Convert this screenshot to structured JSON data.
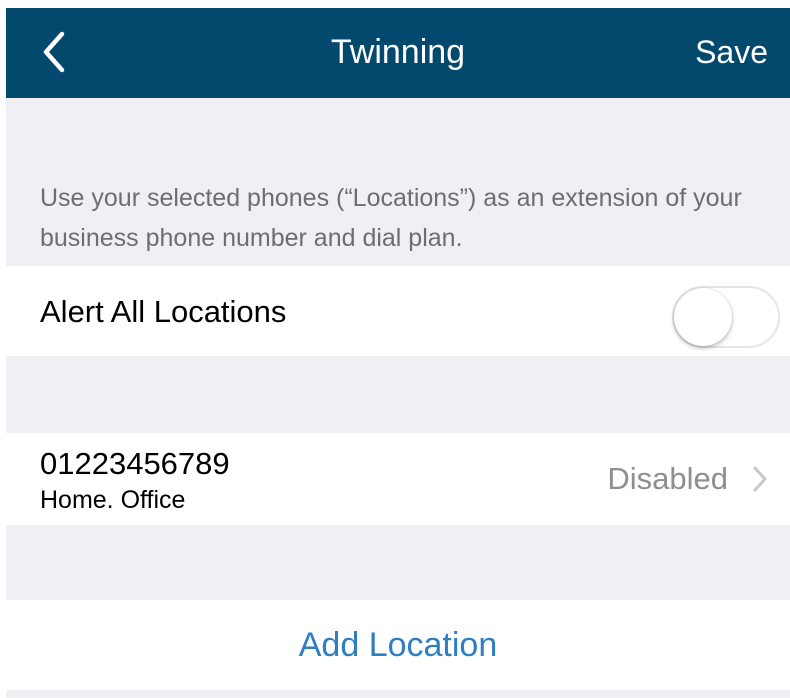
{
  "navbar": {
    "back_icon": "chevron-left-icon",
    "title": "Twinning",
    "save_label": "Save",
    "background_color": "#03486d"
  },
  "description": "Use your selected phones (“Locations”) as an extension of your business phone number and dial plan.",
  "alert_all": {
    "label": "Alert All Locations",
    "enabled": false
  },
  "locations": [
    {
      "number": "01223456789",
      "name": "Home. Office",
      "status": "Disabled",
      "icon": "chevron-right-icon"
    }
  ],
  "add_location_label": "Add Location",
  "accent_color": "#2f7ec2"
}
